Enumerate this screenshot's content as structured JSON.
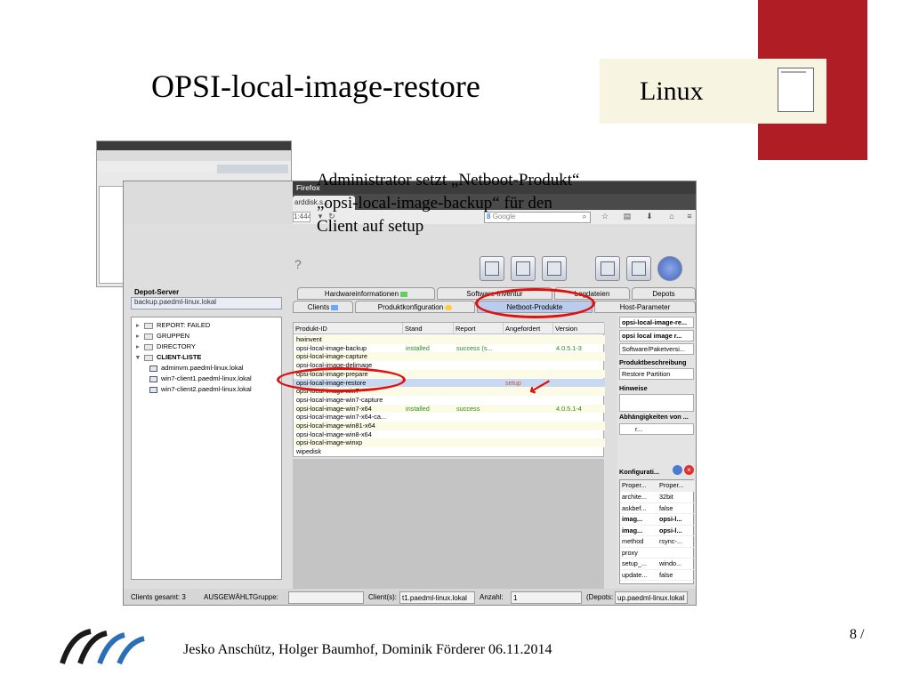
{
  "slide": {
    "title": "OPSI-local-image-restore",
    "os_label": "Linux",
    "annotation_lines": [
      "Administrator setzt „Netboot-Produkt“",
      "„opsi-local-image-backup“ für den",
      "Client auf setup"
    ],
    "footer": "Jesko Anschütz, Holger Baumhof, Dominik Förderer 06.11.2014",
    "page": "8 /"
  },
  "browser": {
    "title": "Firefox",
    "tab_label": "arddisk.s...",
    "url": "1:4447",
    "search_placeholder": "Google"
  },
  "app": {
    "help_icon_label": "?",
    "depot_label": "Depot-Server",
    "depot_value": "backup.paedml-linux.lokal",
    "tree": [
      {
        "label": "REPORT: FAILED",
        "kind": "folder",
        "level": 0
      },
      {
        "label": "GRUPPEN",
        "kind": "folder",
        "level": 0
      },
      {
        "label": "DIRECTORY",
        "kind": "folder",
        "level": 0
      },
      {
        "label": "CLIENT-LISTE",
        "kind": "folder",
        "level": 0,
        "bold": true
      },
      {
        "label": "adminvm.paedml-linux.lokal",
        "kind": "client",
        "level": 1
      },
      {
        "label": "win7-client1.paedml-linux.lokal",
        "kind": "client",
        "level": 1
      },
      {
        "label": "win7-client2.paedml-linux.lokal",
        "kind": "client",
        "level": 1
      }
    ],
    "tabs_top": [
      "Hardwareinformationen",
      "Software-Inventur",
      "Logdateien",
      "Depots"
    ],
    "tabs_bottom": [
      "Clients",
      "Produktkonfiguration",
      "Netboot-Produkte",
      "Host-Parameter"
    ],
    "table": {
      "headers": [
        "Produkt-ID",
        "Stand",
        "Report",
        "Angefordert",
        "Version"
      ],
      "rows": [
        {
          "id": "hwinvent",
          "stand": "",
          "report": "",
          "angefordert": "",
          "version": ""
        },
        {
          "id": "opsi-local-image-backup",
          "stand": "installed",
          "report": "success (s...",
          "angefordert": "",
          "version": "4.0.5.1-3"
        },
        {
          "id": "opsi-local-image-capture",
          "stand": "",
          "report": "",
          "angefordert": "",
          "version": ""
        },
        {
          "id": "opsi-local-image-delimage",
          "stand": "",
          "report": "",
          "angefordert": "",
          "version": ""
        },
        {
          "id": "opsi-local-image-prepare",
          "stand": "",
          "report": "",
          "angefordert": "",
          "version": ""
        },
        {
          "id": "opsi-local-image-restore",
          "stand": "",
          "report": "",
          "angefordert": "setup",
          "version": ""
        },
        {
          "id": "opsi-local-image-win7",
          "stand": "",
          "report": "",
          "angefordert": "",
          "version": ""
        },
        {
          "id": "opsi-local-image-win7-capture",
          "stand": "",
          "report": "",
          "angefordert": "",
          "version": ""
        },
        {
          "id": "opsi-local-image-win7-x64",
          "stand": "installed",
          "report": "success",
          "angefordert": "",
          "version": "4.0.5.1-4"
        },
        {
          "id": "opsi-local-image-win7-x64-ca...",
          "stand": "",
          "report": "",
          "angefordert": "",
          "version": ""
        },
        {
          "id": "opsi-local-image-win81-x64",
          "stand": "",
          "report": "",
          "angefordert": "",
          "version": ""
        },
        {
          "id": "opsi-local-image-win8-x64",
          "stand": "",
          "report": "",
          "angefordert": "",
          "version": ""
        },
        {
          "id": "opsi-local-image-winxp",
          "stand": "",
          "report": "",
          "angefordert": "",
          "version": ""
        },
        {
          "id": "wipedisk",
          "stand": "",
          "report": "",
          "angefordert": "",
          "version": ""
        }
      ]
    },
    "right_panel": {
      "field1": "opsi-local-image-re...",
      "field2": "opsi local image r...",
      "field3": "Software/Paketversi...",
      "desc_label": "Produktbeschreibung",
      "desc_value": "Restore Partition",
      "hint_label": "Hinweise",
      "deps_label": "Abhängigkeiten von ...",
      "deps_value": "r...",
      "config_label": "Konfigurati...",
      "props_headers": [
        "Proper...",
        "Proper..."
      ],
      "props": [
        {
          "k": "archite...",
          "v": "32bit",
          "bold": false
        },
        {
          "k": "askbef...",
          "v": "false",
          "bold": false
        },
        {
          "k": "imag...",
          "v": "opsi-l...",
          "bold": true
        },
        {
          "k": "imag...",
          "v": "opsi-l...",
          "bold": true
        },
        {
          "k": "method",
          "v": "rsync-...",
          "bold": false
        },
        {
          "k": "proxy",
          "v": "",
          "bold": false
        },
        {
          "k": "setup_...",
          "v": "windo...",
          "bold": false
        },
        {
          "k": "update...",
          "v": "false",
          "bold": false
        }
      ]
    },
    "status": {
      "clients_total": "Clients gesamt: 3",
      "selected_label": "AUSGEWÄHLT",
      "group_label": "Gruppe:",
      "group_value": "",
      "client_label": "Client(s):",
      "client_value": "t1.paedml-linux.lokal",
      "count_label": "Anzahl:",
      "count_value": "1",
      "depots_label": "(Depots:",
      "depots_value": "up.paedml-linux.lokal"
    }
  },
  "colors": {
    "accent_red": "#b01d24",
    "highlight_ring": "#e01010",
    "status_green": "#2c8a1e"
  }
}
